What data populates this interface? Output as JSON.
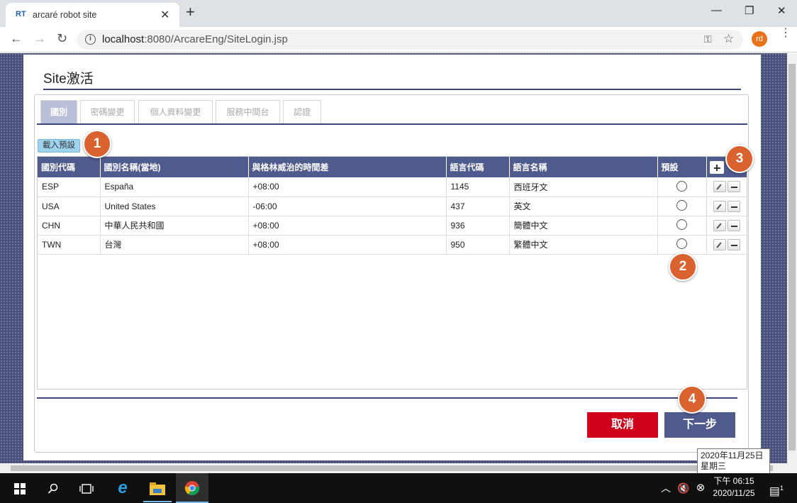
{
  "browser": {
    "tab_icon": "RT",
    "tab_title": "arcaré robot site",
    "url_host": "localhost",
    "url_rest": ":8080/ArcareEng/SiteLogin.jsp",
    "profile": "rd"
  },
  "page": {
    "title": "Site激活",
    "tabs": [
      "國別",
      "密碼變更",
      "個人資料變更",
      "服務中間台",
      "認證"
    ],
    "load_default_label": "載入預設",
    "columns": [
      "國別代碼",
      "國別名稱(當地)",
      "與格林威治的時間差",
      "語言代碼",
      "語言名稱",
      "預設"
    ],
    "rows": [
      {
        "code": "ESP",
        "name": "España",
        "offset": "+08:00",
        "lang_code": "1145",
        "lang_name": "西班牙文"
      },
      {
        "code": "USA",
        "name": "United States",
        "offset": "-06:00",
        "lang_code": "437",
        "lang_name": "英文"
      },
      {
        "code": "CHN",
        "name": "中華人民共和國",
        "offset": "+08:00",
        "lang_code": "936",
        "lang_name": "簡體中文"
      },
      {
        "code": "TWN",
        "name": "台灣",
        "offset": "+08:00",
        "lang_code": "950",
        "lang_name": "繁體中文"
      }
    ],
    "cancel_label": "取消",
    "next_label": "下一步"
  },
  "markers": [
    "1",
    "2",
    "3",
    "4"
  ],
  "tooltip": {
    "line1": "2020年11月25日",
    "line2": "星期三"
  },
  "taskbar": {
    "time": "下午 06:15",
    "date": "2020/11/25",
    "notification_count": "1"
  },
  "colors": {
    "accent": "#4e5b8c",
    "cancel": "#d0021b",
    "marker": "#d9622f",
    "load_button": "#9ed3ee"
  }
}
